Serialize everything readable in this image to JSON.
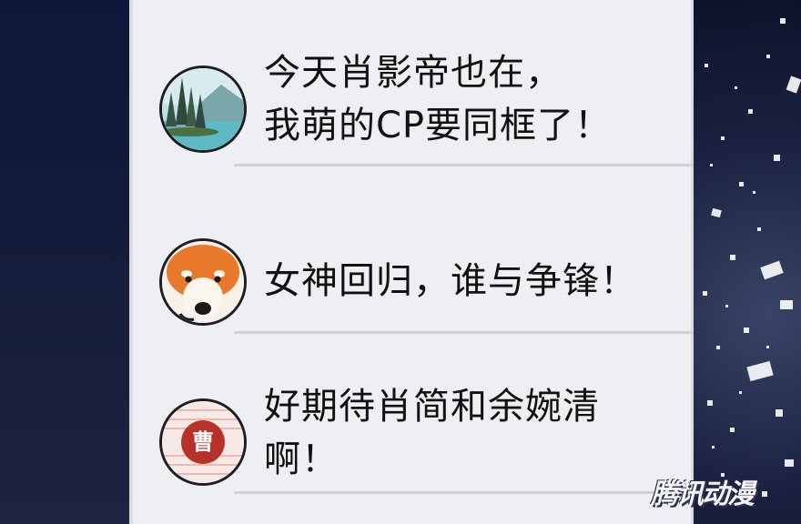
{
  "comments": [
    {
      "avatar": "landscape-lake-avatar",
      "text": "今天肖影帝也在，\n我萌的CP要同框了！"
    },
    {
      "avatar": "shiba-dog-avatar",
      "text": "女神回归，谁与争锋！"
    },
    {
      "avatar": "cao-character-avatar",
      "avatar_char": "曹",
      "text": "好期待肖简和余婉清\n啊！"
    }
  ],
  "watermark": "腾讯动漫",
  "colors": {
    "panel": "#eeeff2",
    "background": "#0b1430",
    "text": "#111111",
    "divider": "#cfd1d6",
    "cao_badge": "#b8322b"
  }
}
